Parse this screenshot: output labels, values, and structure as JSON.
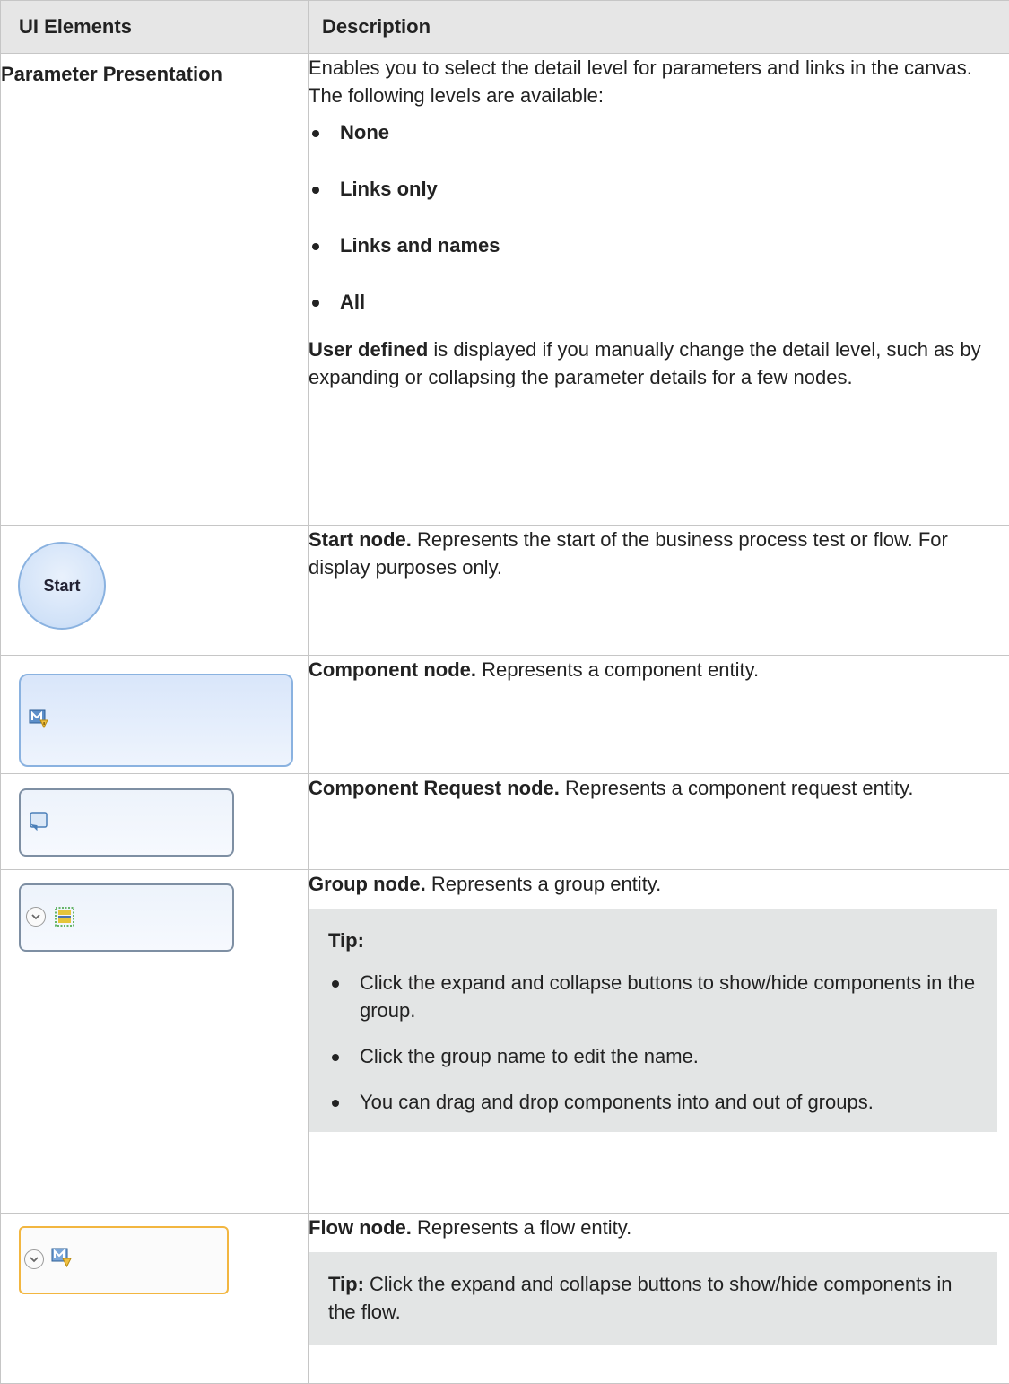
{
  "header": {
    "col1": "UI Elements",
    "col2": "Description"
  },
  "rows": {
    "param": {
      "name": "Parameter Presentation",
      "intro": "Enables you to select the detail level for parameters and links in the canvas. The following levels are available:",
      "levels": [
        "None",
        "Links only",
        "Links and names",
        "All"
      ],
      "note_bold": "User defined",
      "note_rest": " is displayed if you manually change the detail level, such as by expanding or collapsing the parameter details for a few nodes."
    },
    "start": {
      "node_label": "Start",
      "title": "Start node.",
      "text": " Represents the start of the business process test or flow. For display purposes only."
    },
    "component": {
      "title": "Component node.",
      "text": " Represents a component entity."
    },
    "request": {
      "title": "Component Request node.",
      "text": " Represents a component request entity."
    },
    "group": {
      "title": "Group node.",
      "text": " Represents a group entity.",
      "tip_label": "Tip:",
      "tips": [
        "Click the expand and collapse buttons to show/hide components in the group.",
        "Click the group name to edit the name.",
        "You can drag and drop components into and out of groups."
      ]
    },
    "flow": {
      "title": "Flow node.",
      "text": " Represents a flow entity.",
      "tip_label": "Tip:",
      "tip_text": " Click the expand and collapse buttons to show/hide components in the flow."
    }
  }
}
